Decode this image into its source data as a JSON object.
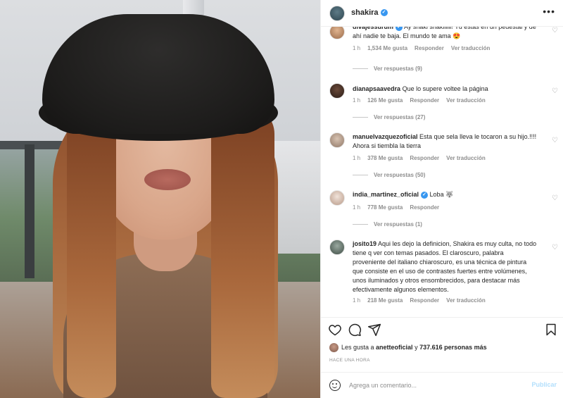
{
  "post": {
    "username": "shakira",
    "more_label": "•••"
  },
  "comments": [
    {
      "username": "divajessurum",
      "verified": true,
      "text": "Ay shaki shakiiiiii! Tú estás en un pedestal y de ahí nadie te baja. El mundo te ama 😍",
      "time": "1 h",
      "likes": "1,534 Me gusta",
      "reply_label": "Responder",
      "translate_label": "Ver traducción",
      "view_replies": "Ver respuestas (9)"
    },
    {
      "username": "dianapsaavedra",
      "verified": false,
      "text": "Que lo supere voltee la página",
      "time": "1 h",
      "likes": "126 Me gusta",
      "reply_label": "Responder",
      "translate_label": "Ver traducción",
      "view_replies": "Ver respuestas (27)"
    },
    {
      "username": "manuelvazquezoficial",
      "verified": false,
      "text": "Esta que sela lleva le tocaron a su hijo.!!!! Ahora si tiembla la tierra",
      "time": "1 h",
      "likes": "378 Me gusta",
      "reply_label": "Responder",
      "translate_label": "Ver traducción",
      "view_replies": "Ver respuestas (50)"
    },
    {
      "username": "india_martinez_oficial",
      "verified": true,
      "text": "Loba 🐺",
      "time": "1 h",
      "likes": "778 Me gusta",
      "reply_label": "Responder",
      "translate_label": "",
      "view_replies": "Ver respuestas (1)"
    },
    {
      "username": "josito19",
      "verified": false,
      "text": "Aqui les dejo la definicion, Shakira es muy culta, no todo tiene q ver con temas pasados. El claroscuro, palabra proveniente del italiano chiaroscuro,  es una técnica de pintura que consiste en el uso de contrastes fuertes entre volúmenes, unos iluminados y otros ensombrecidos, para destacar más efectivamente algunos elementos.",
      "time": "1 h",
      "likes": "218 Me gusta",
      "reply_label": "Responder",
      "translate_label": "Ver traducción",
      "view_replies": ""
    }
  ],
  "likes_summary": {
    "prefix": "Les gusta a ",
    "user": "anetteoficial",
    "middle": " y ",
    "count": "737.616 personas más"
  },
  "timestamp": "HACE UNA HORA",
  "composer": {
    "placeholder": "Agrega un comentario...",
    "post_label": "Publicar"
  },
  "icons": [
    "heart-icon",
    "comment-icon",
    "share-icon",
    "bookmark-icon",
    "emoji-icon",
    "more-icon",
    "verified-icon"
  ],
  "colors": {
    "verified": "#3897f0",
    "muted": "#8e8e8e",
    "publish_disabled": "#b2dffc",
    "text": "#262626"
  }
}
